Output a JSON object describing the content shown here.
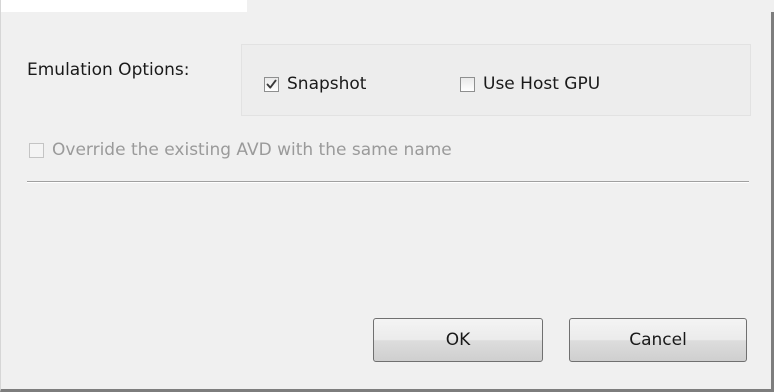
{
  "emulation": {
    "label": "Emulation Options:",
    "snapshot": {
      "label": "Snapshot",
      "checked": true
    },
    "use_host_gpu": {
      "label": "Use Host GPU",
      "checked": false
    }
  },
  "override": {
    "label": "Override the existing AVD with the same name",
    "checked": false,
    "enabled": false
  },
  "buttons": {
    "ok_label": "OK",
    "cancel_label": "Cancel"
  },
  "colors": {
    "dialog_bg": "#f0f0f0",
    "disabled_text": "#9a9a9a"
  }
}
